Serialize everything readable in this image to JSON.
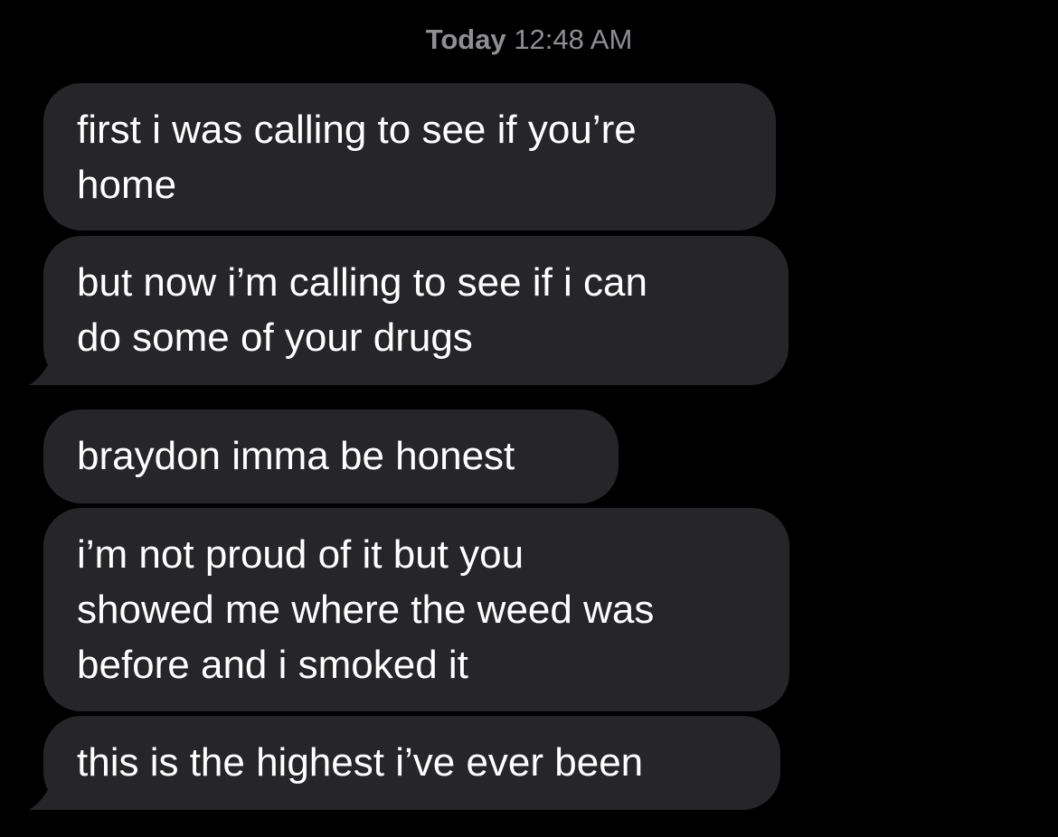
{
  "conversation": {
    "timestamp": {
      "day": "Today",
      "time": "12:48 AM"
    },
    "messages": [
      {
        "lines": [
          "first i was calling to see if you’re",
          "home"
        ],
        "has_tail": false
      },
      {
        "lines": [
          "but now i’m calling to see if i can",
          "do some of your drugs"
        ],
        "has_tail": true
      },
      {
        "lines": [
          "braydon imma be honest"
        ],
        "has_tail": false
      },
      {
        "lines": [
          "i’m not proud of it but you",
          "showed me where the weed was",
          "before and i smoked it"
        ],
        "has_tail": false
      },
      {
        "lines": [
          "this is the highest i’ve ever been"
        ],
        "has_tail": true
      }
    ]
  },
  "theme": {
    "background": "#000000",
    "bubble_incoming": "#262628",
    "text_primary": "#ffffff",
    "text_secondary": "#8e8e93"
  }
}
